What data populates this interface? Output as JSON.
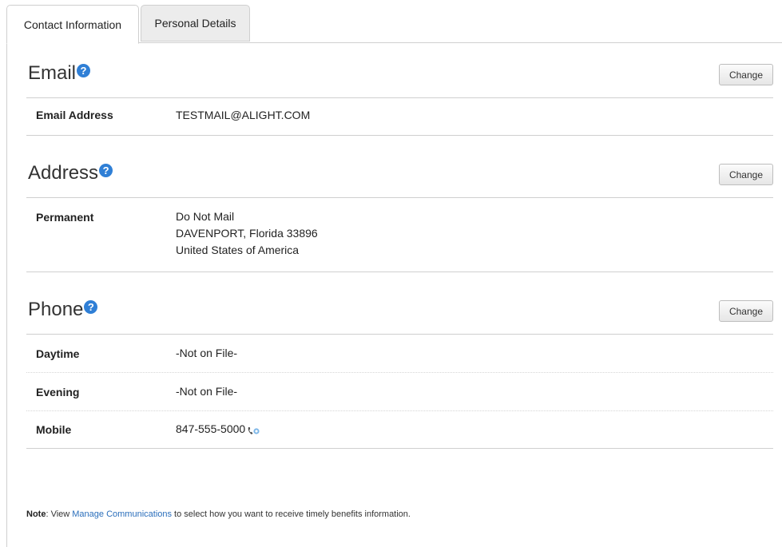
{
  "tabs": [
    {
      "label": "Contact Information",
      "active": true
    },
    {
      "label": "Personal Details",
      "active": false
    }
  ],
  "email": {
    "title": "Email",
    "change_label": "Change",
    "rows": [
      {
        "label": "Email Address",
        "value": "TESTMAIL@ALIGHT.COM"
      }
    ]
  },
  "address": {
    "title": "Address",
    "change_label": "Change",
    "label": "Permanent",
    "lines": [
      "Do Not Mail",
      "DAVENPORT, Florida 33896",
      "United States of America"
    ]
  },
  "phone": {
    "title": "Phone",
    "change_label": "Change",
    "rows": [
      {
        "label": "Daytime",
        "value": "-Not on File-"
      },
      {
        "label": "Evening",
        "value": "-Not on File-"
      },
      {
        "label": "Mobile",
        "value": "847-555-5000"
      }
    ]
  },
  "note": {
    "prefix": "Note",
    "text_before": ": View ",
    "link": "Manage Communications",
    "text_after": " to select how you want to receive timely benefits information."
  },
  "icons": {
    "help": "help-icon",
    "phone": "phone-icon"
  },
  "colors": {
    "accent": "#2f7fd6",
    "link": "#2a6ebb"
  }
}
